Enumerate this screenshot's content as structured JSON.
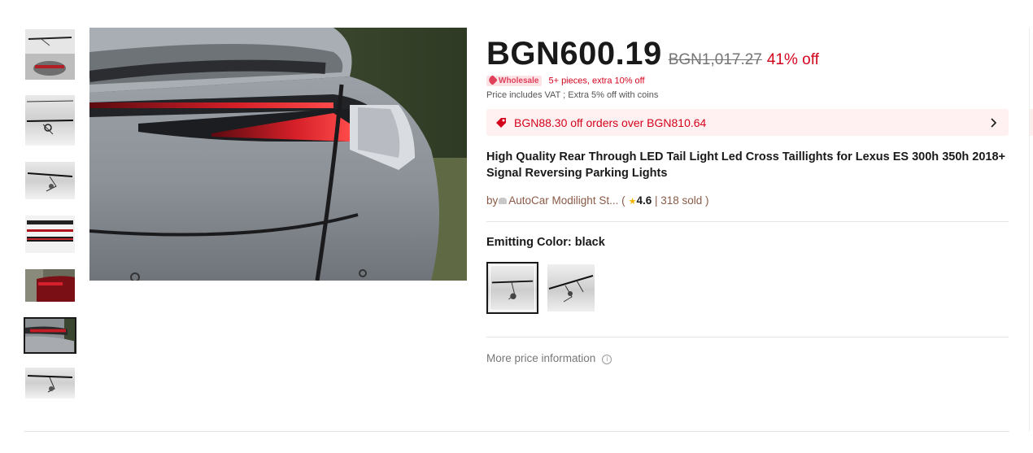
{
  "gallery": {
    "thumbnails": [
      {
        "name": "thumb-1"
      },
      {
        "name": "thumb-2"
      },
      {
        "name": "thumb-3"
      },
      {
        "name": "thumb-4"
      },
      {
        "name": "thumb-5"
      },
      {
        "name": "thumb-6",
        "selected": true
      },
      {
        "name": "thumb-7"
      }
    ]
  },
  "price": {
    "current": "BGN600.19",
    "original": "BGN1,017.27",
    "discount": "41% off",
    "accent_color": "#d3031c"
  },
  "wholesale": {
    "badge": "Wholesale",
    "text": "5+ pieces, extra 10% off"
  },
  "vat_note": "Price includes VAT ; Extra 5% off with coins",
  "coupon": {
    "text": "BGN88.30 off orders over BGN810.64",
    "icon": "tag-icon",
    "chevron": "chevron-right-icon"
  },
  "product": {
    "title": "High Quality Rear Through LED Tail Light Led Cross Taillights for Lexus ES 300h 350h 2018+ Signal Reversing Parking Lights"
  },
  "store": {
    "by": "by",
    "name": "AutoCar Modilight St...",
    "open_paren": " (",
    "rating": "4.6",
    "separator": " | ",
    "sold": "318 sold",
    "close_paren": " )"
  },
  "variant": {
    "label": "Emitting Color: black"
  },
  "more_price_info": "More price information"
}
